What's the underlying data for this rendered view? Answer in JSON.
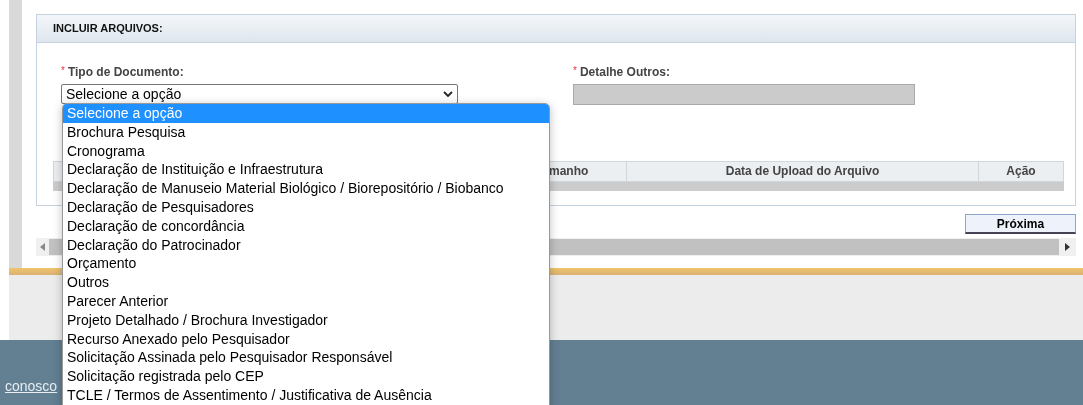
{
  "section": {
    "title": "INCLUIR ARQUIVOS:"
  },
  "fields": [
    {
      "kind": "select",
      "label": "Tipo de Documento:",
      "required_mark": "*",
      "value": "Selecione a opção",
      "disabled": false
    },
    {
      "kind": "text",
      "label": "Detalhe Outros:",
      "required_mark": "*",
      "disabled": true
    }
  ],
  "dropdown": {
    "options": [
      {
        "label": "Selecione a opção",
        "selected": true
      },
      {
        "label": "Brochura Pesquisa",
        "selected": false
      },
      {
        "label": "Cronograma",
        "selected": false
      },
      {
        "label": "Declaração de Instituição e Infraestrutura",
        "selected": false
      },
      {
        "label": "Declaração de Manuseio Material Biológico / Biorepositório / Biobanco",
        "selected": false
      },
      {
        "label": "Declaração de Pesquisadores",
        "selected": false
      },
      {
        "label": "Declaração de concordância",
        "selected": false
      },
      {
        "label": "Declaração do Patrocinador",
        "selected": false
      },
      {
        "label": "Orçamento",
        "selected": false
      },
      {
        "label": "Outros",
        "selected": false
      },
      {
        "label": "Parecer Anterior",
        "selected": false
      },
      {
        "label": "Projeto Detalhado / Brochura Investigador",
        "selected": false
      },
      {
        "label": "Recurso Anexado pelo Pesquisador",
        "selected": false
      },
      {
        "label": "Solicitação Assinada pelo Pesquisador Responsável",
        "selected": false
      },
      {
        "label": "Solicitação registrada pelo CEP",
        "selected": false
      },
      {
        "label": "TCLE / Termos de Assentimento / Justificativa de Ausência",
        "selected": false
      }
    ]
  },
  "table": {
    "columns": [
      "manho",
      "Data de Upload do Arquivo",
      "Ação"
    ]
  },
  "next_button": "Próxima",
  "footer": {
    "link": "conosco"
  }
}
